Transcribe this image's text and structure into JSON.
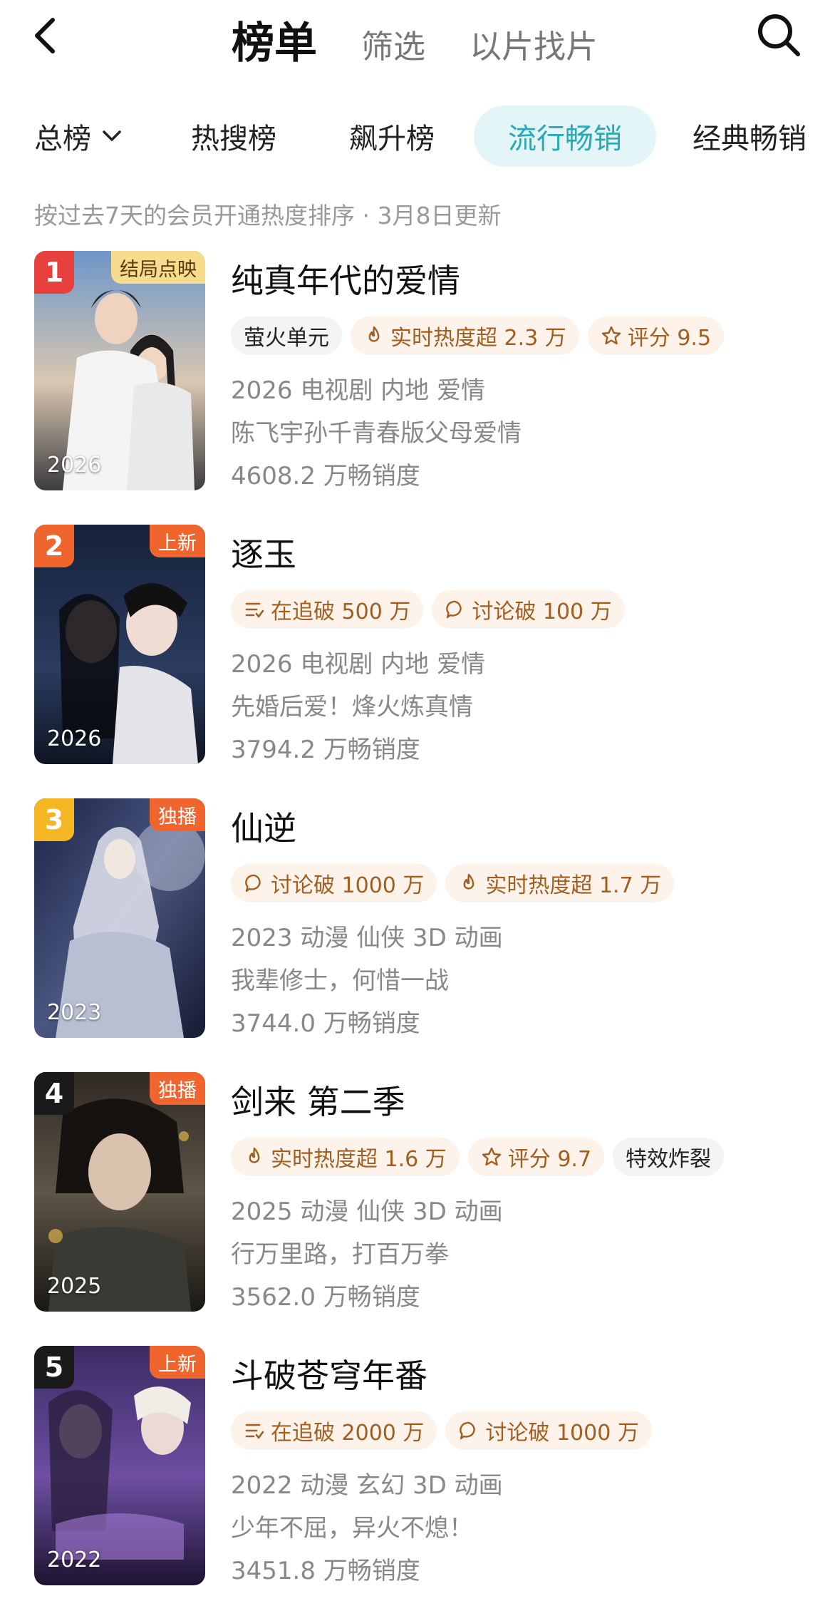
{
  "header": {
    "back_icon": "chevron-left-icon",
    "tabs": [
      {
        "label": "榜单",
        "active": true
      },
      {
        "label": "筛选",
        "active": false
      },
      {
        "label": "以片找片",
        "active": false
      }
    ],
    "search_icon": "search-icon"
  },
  "category_tabs": [
    {
      "label": "总榜",
      "dropdown": true,
      "active": false
    },
    {
      "label": "热搜榜",
      "active": false
    },
    {
      "label": "飙升榜",
      "active": false
    },
    {
      "label": "流行畅销",
      "active": true
    },
    {
      "label": "经典畅销",
      "active": false
    }
  ],
  "subtitle": "按过去7天的会员开通热度排序 · 3月8日更新",
  "colors": {
    "accent_teal": "#28a9b5",
    "rank1": "#e8403c",
    "rank2": "#f0642d",
    "rank3": "#f5b623",
    "rank_other": "#1a1a1a",
    "tag_text": "#a25e21",
    "tag_bg": "#fdf3ea"
  },
  "items": [
    {
      "rank": "1",
      "corner": "结局点映",
      "year": "2026",
      "title": "纯真年代的爱情",
      "tags": [
        {
          "icon": "",
          "text": "萤火单元",
          "style": "gray"
        },
        {
          "icon": "flame-icon",
          "text": "实时热度超 2.3 万",
          "style": "warm"
        },
        {
          "icon": "star-icon",
          "text": "评分 9.5",
          "style": "warm"
        }
      ],
      "meta": "2026 电视剧 内地 爱情",
      "desc": "陈飞宇孙千青春版父母爱情",
      "sales": "4608.2 万畅销度"
    },
    {
      "rank": "2",
      "corner": "上新",
      "year": "2026",
      "title": "逐玉",
      "tags": [
        {
          "icon": "list-icon",
          "text": "在追破 500 万",
          "style": "warm"
        },
        {
          "icon": "comment-icon",
          "text": "讨论破 100 万",
          "style": "warm"
        }
      ],
      "meta": "2026 电视剧 内地 爱情",
      "desc": "先婚后爱！烽火炼真情",
      "sales": "3794.2 万畅销度"
    },
    {
      "rank": "3",
      "corner": "独播",
      "year": "2023",
      "title": "仙逆",
      "tags": [
        {
          "icon": "comment-icon",
          "text": "讨论破 1000 万",
          "style": "warm"
        },
        {
          "icon": "flame-icon",
          "text": "实时热度超 1.7 万",
          "style": "warm"
        }
      ],
      "meta": "2023 动漫 仙侠 3D 动画",
      "desc": "我辈修士，何惜一战",
      "sales": "3744.0 万畅销度"
    },
    {
      "rank": "4",
      "corner": "独播",
      "year": "2025",
      "title": "剑来 第二季",
      "tags": [
        {
          "icon": "flame-icon",
          "text": "实时热度超 1.6 万",
          "style": "warm"
        },
        {
          "icon": "star-icon",
          "text": "评分 9.7",
          "style": "warm"
        },
        {
          "icon": "",
          "text": "特效炸裂",
          "style": "gray"
        }
      ],
      "meta": "2025 动漫 仙侠 3D 动画",
      "desc": "行万里路，打百万拳",
      "sales": "3562.0 万畅销度"
    },
    {
      "rank": "5",
      "corner": "上新",
      "year": "2022",
      "title": "斗破苍穹年番",
      "tags": [
        {
          "icon": "list-icon",
          "text": "在追破 2000 万",
          "style": "warm"
        },
        {
          "icon": "comment-icon",
          "text": "讨论破 1000 万",
          "style": "warm"
        }
      ],
      "meta": "2022 动漫 玄幻 3D 动画",
      "desc": "少年不屈，异火不熄！",
      "sales": "3451.8 万畅销度"
    }
  ]
}
